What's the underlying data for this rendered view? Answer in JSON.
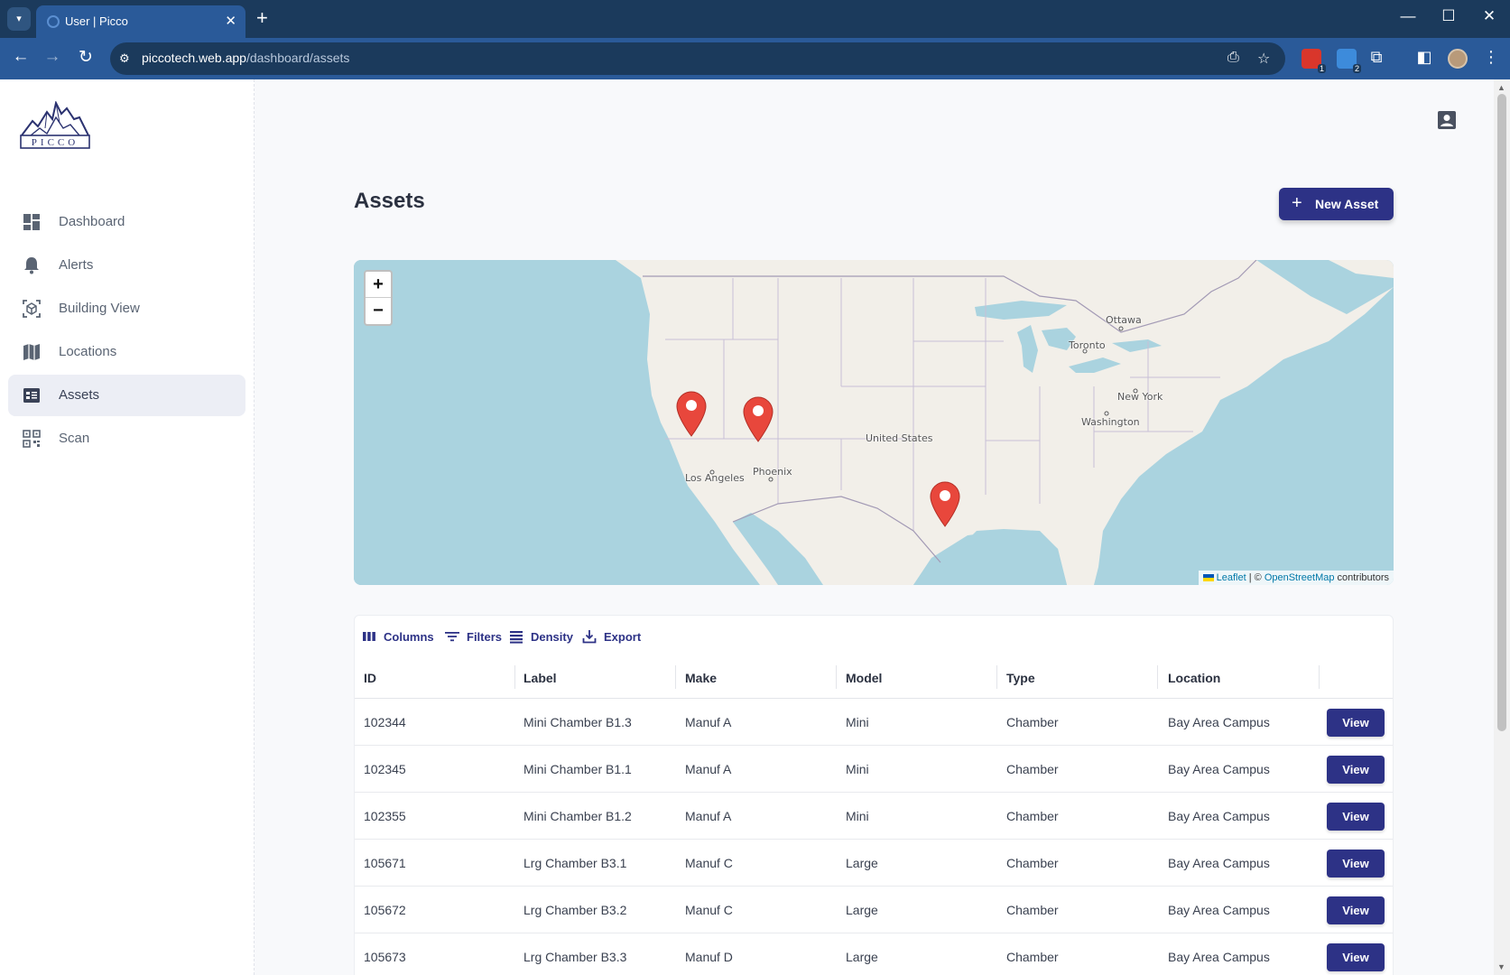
{
  "browser": {
    "tab_title": "User | Picco",
    "url_host": "piccotech.web.app",
    "url_path": "/dashboard/assets",
    "ext_badge_1": "1",
    "ext_badge_2": "2"
  },
  "sidebar": {
    "logo_text": "PICCO",
    "items": [
      {
        "label": "Dashboard",
        "icon": "dashboard-icon"
      },
      {
        "label": "Alerts",
        "icon": "bell-icon"
      },
      {
        "label": "Building View",
        "icon": "building-view-icon"
      },
      {
        "label": "Locations",
        "icon": "map-icon"
      },
      {
        "label": "Assets",
        "icon": "assets-icon",
        "active": true
      },
      {
        "label": "Scan",
        "icon": "qr-scan-icon"
      }
    ]
  },
  "page": {
    "title": "Assets",
    "new_asset_label": "New Asset"
  },
  "map": {
    "zoom_in": "+",
    "zoom_out": "−",
    "labels": {
      "ottawa": "Ottawa",
      "toronto": "Toronto",
      "new_york": "New York",
      "washington": "Washington",
      "united_states": "United States",
      "phoenix": "Phoenix",
      "los_angeles": "Los Angeles"
    },
    "markers": 3,
    "attribution": {
      "leaflet": "Leaflet",
      "sep": " | © ",
      "osm": "OpenStreetMap",
      "contributors": " contributors"
    }
  },
  "grid": {
    "toolbar": {
      "columns": "Columns",
      "filters": "Filters",
      "density": "Density",
      "export": "Export"
    },
    "headers": {
      "id": "ID",
      "label": "Label",
      "make": "Make",
      "model": "Model",
      "type": "Type",
      "location": "Location"
    },
    "view_label": "View",
    "rows": [
      {
        "id": "102344",
        "label": "Mini Chamber B1.3",
        "make": "Manuf A",
        "model": "Mini",
        "type": "Chamber",
        "location": "Bay Area Campus"
      },
      {
        "id": "102345",
        "label": "Mini Chamber B1.1",
        "make": "Manuf A",
        "model": "Mini",
        "type": "Chamber",
        "location": "Bay Area Campus"
      },
      {
        "id": "102355",
        "label": "Mini Chamber B1.2",
        "make": "Manuf A",
        "model": "Mini",
        "type": "Chamber",
        "location": "Bay Area Campus"
      },
      {
        "id": "105671",
        "label": "Lrg Chamber B3.1",
        "make": "Manuf C",
        "model": "Large",
        "type": "Chamber",
        "location": "Bay Area Campus"
      },
      {
        "id": "105672",
        "label": "Lrg Chamber B3.2",
        "make": "Manuf C",
        "model": "Large",
        "type": "Chamber",
        "location": "Bay Area Campus"
      },
      {
        "id": "105673",
        "label": "Lrg Chamber B3.3",
        "make": "Manuf D",
        "model": "Large",
        "type": "Chamber",
        "location": "Bay Area Campus"
      }
    ]
  },
  "colors": {
    "primary": "#2d3286",
    "chrome_dark": "#1b3a5c",
    "chrome": "#2a5a99",
    "marker": "#e8473c",
    "water": "#aad3df",
    "land": "#f2efe9"
  }
}
